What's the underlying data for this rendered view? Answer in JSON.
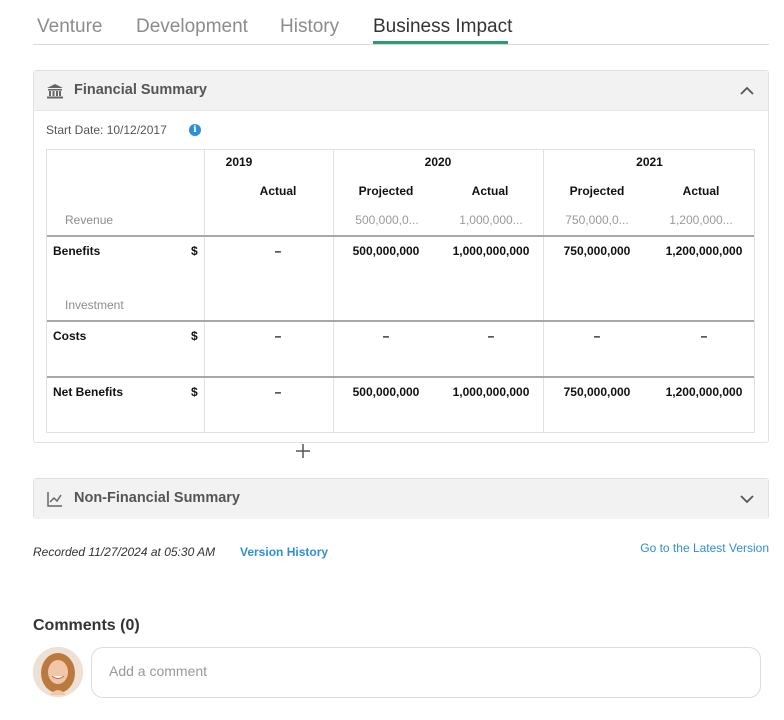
{
  "tabs": [
    {
      "label": "Venture"
    },
    {
      "label": "Development"
    },
    {
      "label": "History"
    },
    {
      "label": "Business Impact"
    }
  ],
  "active_tab": "Business Impact",
  "financial_summary": {
    "title": "Financial Summary",
    "icon": "bank-icon",
    "expanded": true,
    "start_date": "Start Date: 10/12/2017",
    "table": {
      "years": [
        "2019",
        "2020",
        "2021"
      ],
      "subheaders": [
        "Actual",
        "Projected",
        "Actual",
        "Projected",
        "Actual"
      ],
      "revenue_label": "Revenue",
      "revenue_values": [
        "500,000,0...",
        "1,000,000...",
        "750,000,0...",
        "1,200,000..."
      ],
      "rows": [
        {
          "label": "Benefits",
          "currency": "$",
          "values": [
            "–",
            "500,000,000",
            "1,000,000,000",
            "750,000,000",
            "1,200,000,000"
          ]
        },
        {
          "group_label": "Investment"
        },
        {
          "label": "Costs",
          "currency": "$",
          "values": [
            "–",
            "–",
            "–",
            "–",
            "–"
          ]
        },
        {
          "label": "Net Benefits",
          "currency": "$",
          "values": [
            "–",
            "500,000,000",
            "1,000,000,000",
            "750,000,000",
            "1,200,000,000"
          ]
        }
      ]
    }
  },
  "non_financial_summary": {
    "title": "Non-Financial Summary",
    "icon": "line-chart-icon",
    "expanded": false
  },
  "recorded_text": "Recorded 11/27/2024 at 05:30 AM",
  "version_history_label": "Version History",
  "latest_version_label": "Go to the Latest Version",
  "comments": {
    "title": "Comments (0)",
    "placeholder": "Add a comment"
  },
  "colors": {
    "accent_tab": "#2a9d6f",
    "link": "#2f8fd6",
    "panel_header_bg": "#f2f2f2"
  }
}
